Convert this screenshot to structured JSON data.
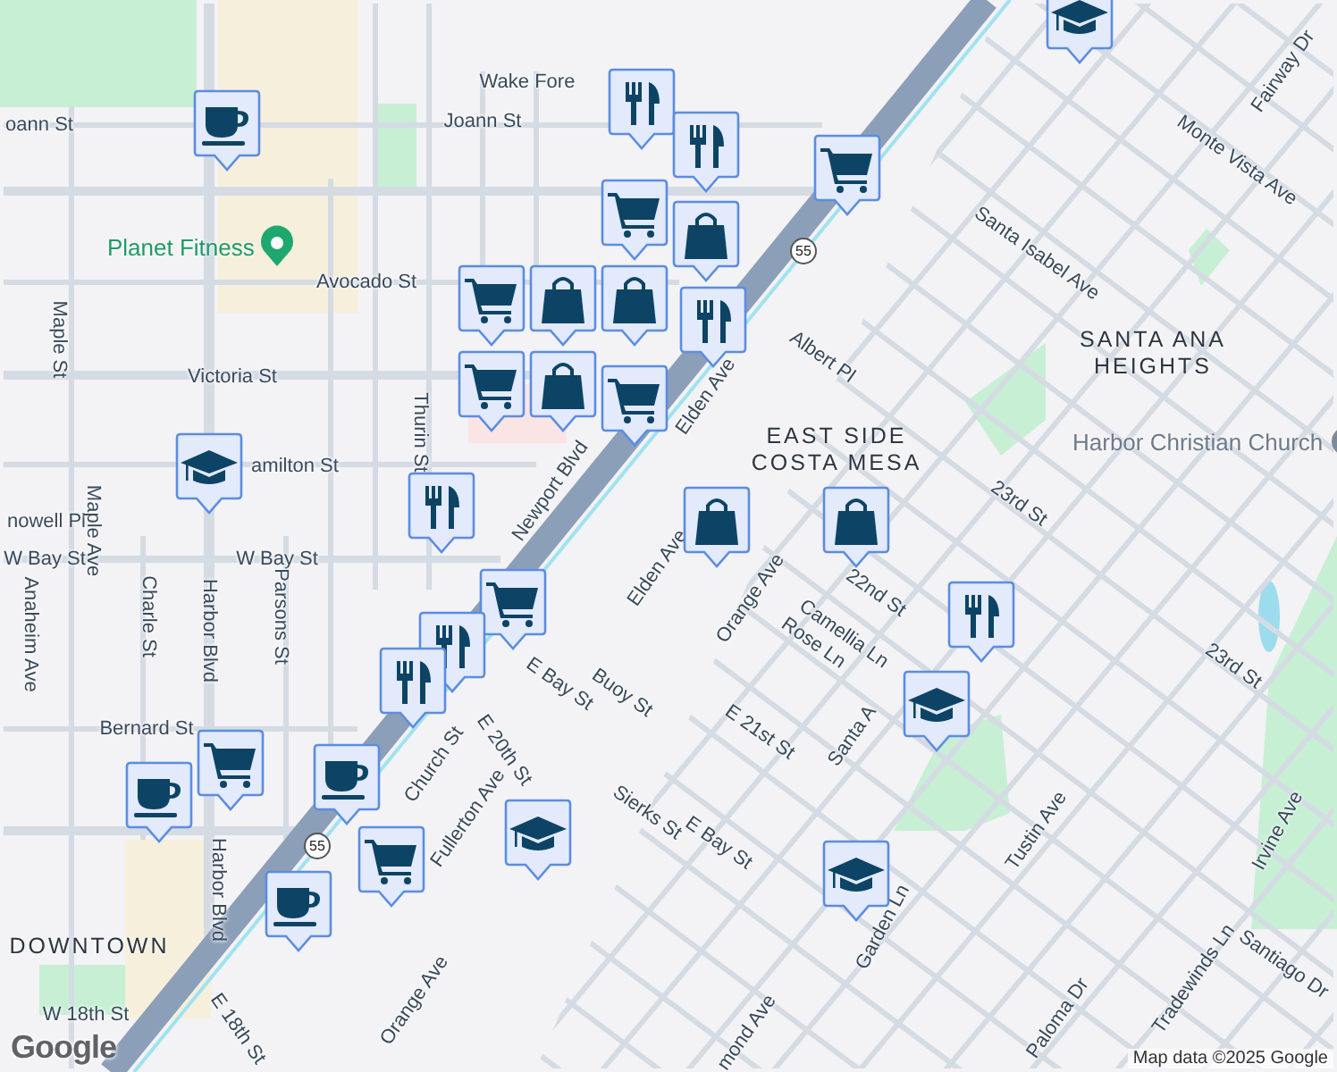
{
  "map": {
    "areas": [
      {
        "name": "SANTA ANA\nHEIGHTS"
      },
      {
        "name": "EAST SIDE\nCOSTA MESA"
      },
      {
        "name": "DOWNTOWN"
      }
    ],
    "places": [
      {
        "name": "Planet Fitness",
        "kind": "gym"
      },
      {
        "name": "Harbor Christian Church",
        "kind": "church"
      }
    ],
    "streets": [
      "oann St",
      "Joann St",
      "Wake Fore",
      "Avocado St",
      "Victoria St",
      "Maple St",
      "amilton St",
      "Thurin St",
      "Newport Blvd",
      "nowell Pl",
      "Maple Ave",
      "W Bay St",
      "W Bay St",
      "Anaheim Ave",
      "Charle St",
      "Harbor Blvd",
      "Parsons St",
      "Bernard St",
      "Harbor Blvd",
      "Church St",
      "E 20th St",
      "E Bay St",
      "Buoy St",
      "Fullerton Ave",
      "Sierks St",
      "E Bay St",
      "E 21st St",
      "Elden Ave",
      "Elden Ave",
      "Albert Pl",
      "Orange Ave",
      "Camellia Ln",
      "Rose Ln",
      "22nd St",
      "Santa A",
      "Tustin Ave",
      "23rd St",
      "23rd St",
      "Santa Isabel Ave",
      "Monte Vista Ave",
      "Fairway Dr",
      "Irvine Ave",
      "Santiago Dr",
      "Tradewinds Ln",
      "Garden Ln",
      "Orange Ave",
      "E 18th St",
      "W 18th St",
      "Paloma Dr",
      "mond Ave"
    ],
    "shields": [
      "55",
      "55"
    ],
    "markers": [
      {
        "kind": "cafe"
      },
      {
        "kind": "restaurant"
      },
      {
        "kind": "restaurant"
      },
      {
        "kind": "grocery"
      },
      {
        "kind": "grocery"
      },
      {
        "kind": "shopping"
      },
      {
        "kind": "shopping"
      },
      {
        "kind": "shopping"
      },
      {
        "kind": "grocery"
      },
      {
        "kind": "shopping"
      },
      {
        "kind": "restaurant"
      },
      {
        "kind": "grocery"
      },
      {
        "kind": "grocery"
      },
      {
        "kind": "school"
      },
      {
        "kind": "restaurant"
      },
      {
        "kind": "shopping"
      },
      {
        "kind": "shopping"
      },
      {
        "kind": "grocery"
      },
      {
        "kind": "restaurant"
      },
      {
        "kind": "restaurant"
      },
      {
        "kind": "school"
      },
      {
        "kind": "restaurant"
      },
      {
        "kind": "grocery"
      },
      {
        "kind": "cafe"
      },
      {
        "kind": "cafe"
      },
      {
        "kind": "grocery"
      },
      {
        "kind": "cafe"
      },
      {
        "kind": "school"
      },
      {
        "kind": "school"
      },
      {
        "kind": "school"
      }
    ],
    "logo": "Google",
    "attribution": "Map data ©2025 Google"
  }
}
